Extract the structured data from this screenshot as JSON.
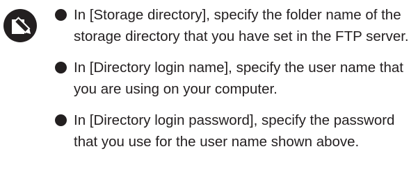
{
  "icon": {
    "name": "note-pencil-icon"
  },
  "notes": [
    {
      "text": "In [Storage directory], specify the folder name of the storage directory that you have set in the FTP server."
    },
    {
      "text": "In [Directory login name], specify the user name that you are using on your computer."
    },
    {
      "text": "In [Directory login password], specify the password that you use for the user name shown above."
    }
  ]
}
